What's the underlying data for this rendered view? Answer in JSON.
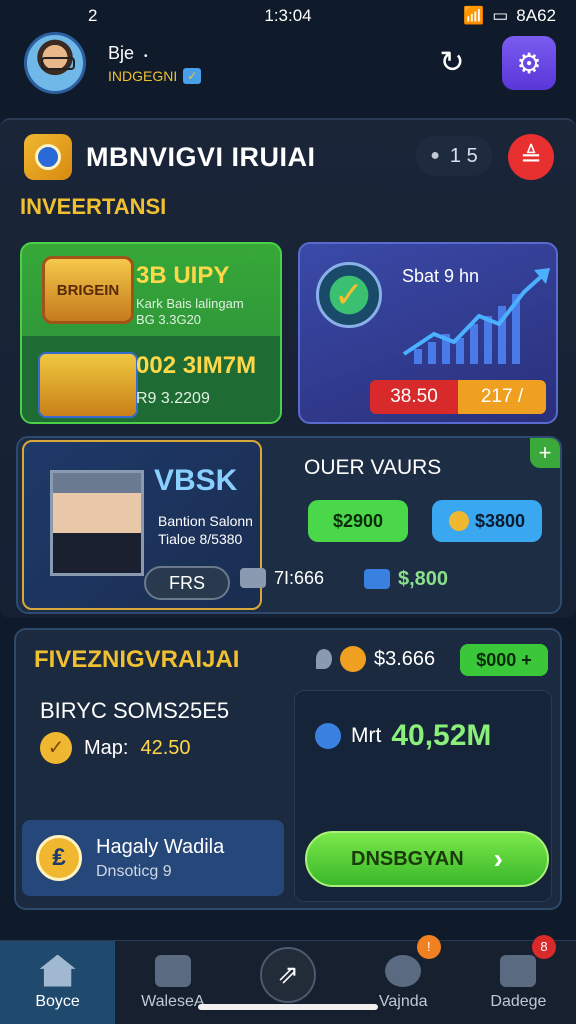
{
  "status": {
    "left": "2",
    "time": "1:3:04",
    "battery": "8A62"
  },
  "user": {
    "name": "Bje",
    "subtitle": "INDGEGNI"
  },
  "panel": {
    "title": "MBNVIGVI IRUIAI",
    "counter": "1 5",
    "section": "INVEERTANSI"
  },
  "cards": {
    "green_top_value": "3B UIPY",
    "green_top_sub1": "Kark Bais lalingam",
    "green_top_sub2": "BG 3.3G20",
    "green_badge": "BRIGEIN",
    "green_bottom_value": "002 3IM7M",
    "green_bottom_sub": "R9 3.2209",
    "chart_label": "Sbat 9 hn",
    "chart_btn_red": "38.50",
    "chart_btn_orange": "217 /"
  },
  "profile": {
    "name": "VBSK",
    "sub": "Bantion Salonn Tialoe 8/5380",
    "button": "FRS",
    "right_title": "OUER VAURS",
    "pill_green": "$2900",
    "pill_blue": "$3800",
    "stat1": "7I:666",
    "stat2": "$,800"
  },
  "bottom": {
    "title": "FIVEZNIGVRAIJAI",
    "coins": "$3.666",
    "add_btn": "$000 +",
    "stat_title": "BIRYC SOMS25E5",
    "stat_label": "Map:",
    "stat_value": "42.50",
    "mkt_label": "Mrt",
    "mkt_value": "40,52M",
    "cta": "DNSBGYAN",
    "wallet_title": "Hagaly Wadila",
    "wallet_sub": "Dnsoticg 9"
  },
  "nav": [
    {
      "label": "Boyce"
    },
    {
      "label": "WaleseA"
    },
    {
      "label": ""
    },
    {
      "label": "Vajnda"
    },
    {
      "label": "Dadege"
    }
  ]
}
